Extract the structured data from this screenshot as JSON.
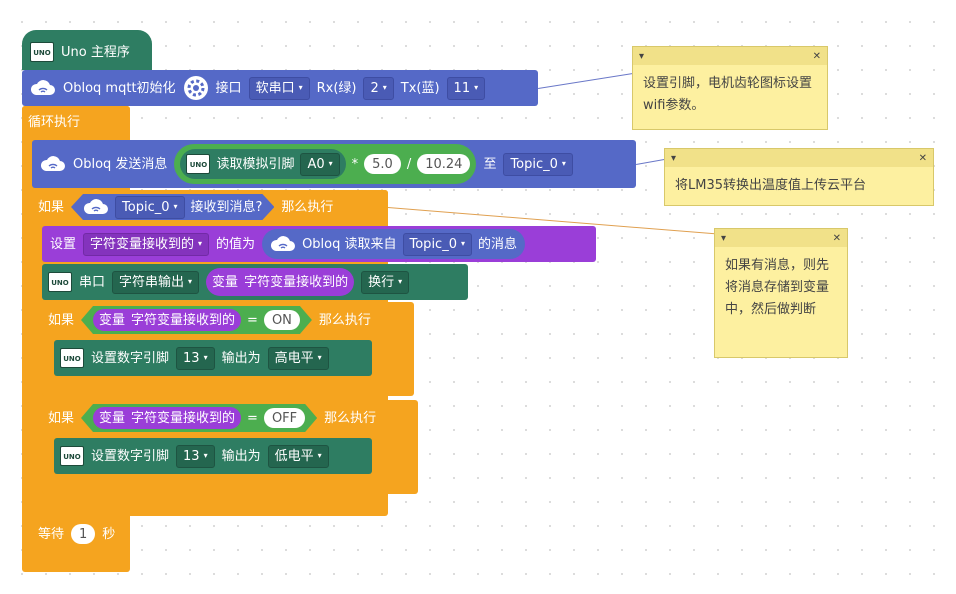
{
  "main_program": {
    "title": "Uno 主程序"
  },
  "obloq_init": {
    "label": "Obloq mqtt初始化",
    "port_label": "接口",
    "port_value": "软串口",
    "rx_label": "Rx(绿)",
    "rx_value": "2",
    "tx_label": "Tx(蓝)",
    "tx_value": "11"
  },
  "loop": {
    "label": "循环执行"
  },
  "send": {
    "label": "Obloq 发送消息",
    "read_analog_label": "读取模拟引脚",
    "analog_pin": "A0",
    "multiply_sign": "*",
    "multiplier": "5.0",
    "divide_sign": "/",
    "divisor": "10.24",
    "to_label": "至",
    "topic": "Topic_0"
  },
  "if_received": {
    "if_label": "如果",
    "topic": "Topic_0",
    "condition_label": "接收到消息?",
    "then_label": "那么执行"
  },
  "set_var": {
    "set_label": "设置",
    "var_name": "字符变量接收到的",
    "value_label": "的值为",
    "read_label": "Obloq 读取来自",
    "topic": "Topic_0",
    "suffix": "的消息"
  },
  "serial": {
    "label": "串口",
    "mode": "字符串输出",
    "var_prefix": "变量",
    "var_name": "字符变量接收到的",
    "newline": "换行"
  },
  "if_on": {
    "if_label": "如果",
    "var_prefix": "变量",
    "var_name": "字符变量接收到的",
    "op": "=",
    "value": "ON",
    "then_label": "那么执行"
  },
  "set_pin_high": {
    "label": "设置数字引脚",
    "pin": "13",
    "output_label": "输出为",
    "level": "高电平"
  },
  "if_off": {
    "if_label": "如果",
    "var_prefix": "变量",
    "var_name": "字符变量接收到的",
    "op": "=",
    "value": "OFF",
    "then_label": "那么执行"
  },
  "set_pin_low": {
    "label": "设置数字引脚",
    "pin": "13",
    "output_label": "输出为",
    "level": "低电平"
  },
  "wait": {
    "label": "等待",
    "value": "1",
    "unit": "秒"
  },
  "uno_icon_text": "UNO",
  "caret": "▾",
  "notes": [
    {
      "text": "设置引脚，电机齿轮图标设置wifi参数。",
      "close": "✕",
      "collapse": "▾"
    },
    {
      "text": "将LM35转换出温度值上传云平台",
      "close": "✕",
      "collapse": "▾"
    },
    {
      "text": "如果有消息，则先将消息存储到变量中，然后做判断",
      "close": "✕",
      "collapse": "▾"
    }
  ],
  "colors": {
    "setup": "#2e7d62",
    "obloq": "#5569c7",
    "control": "#f5a41f",
    "variable": "#9a3ed8",
    "note": "#fdf0a0"
  }
}
